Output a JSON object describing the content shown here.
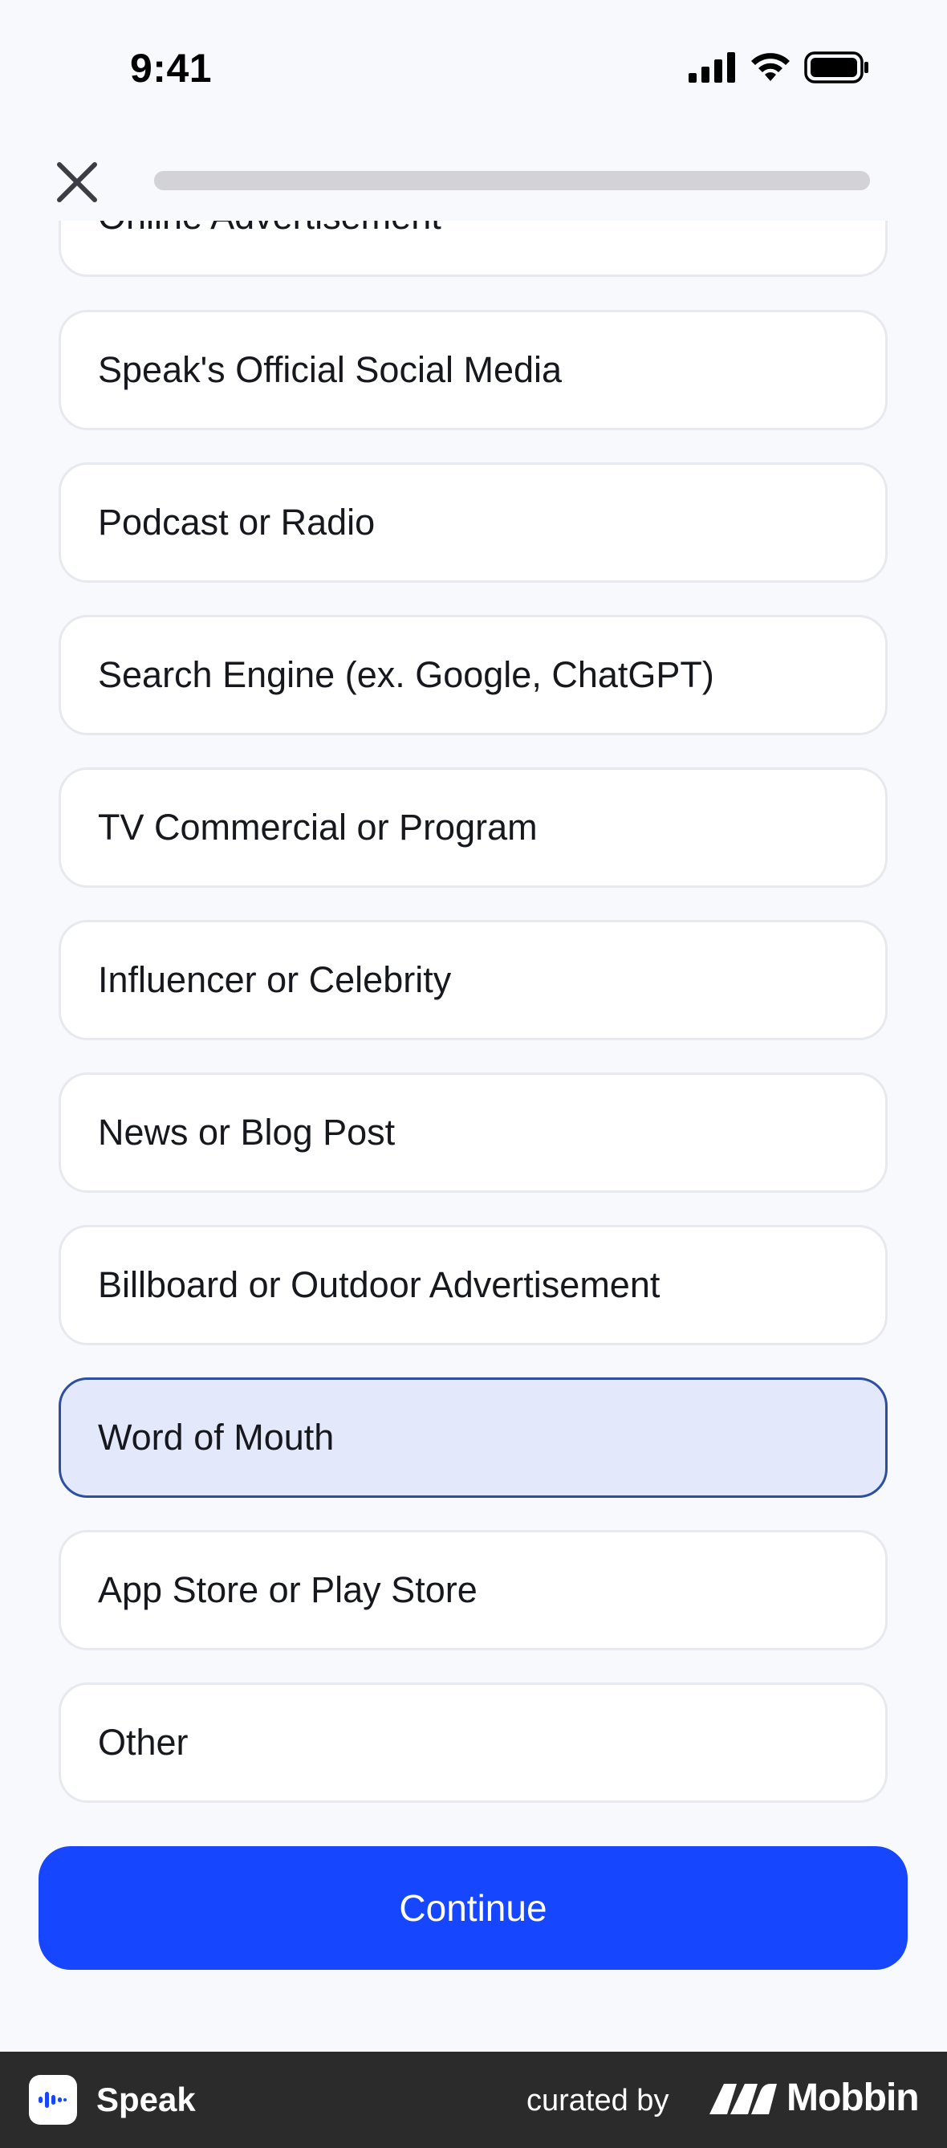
{
  "status_bar": {
    "time": "9:41"
  },
  "header": {
    "close_icon": "close-icon",
    "progress_percent": 100
  },
  "options": [
    {
      "label": "Online Advertisement",
      "selected": false
    },
    {
      "label": "Speak's Official Social Media",
      "selected": false
    },
    {
      "label": "Podcast or Radio",
      "selected": false
    },
    {
      "label": "Search Engine (ex. Google, ChatGPT)",
      "selected": false
    },
    {
      "label": "TV Commercial or Program",
      "selected": false
    },
    {
      "label": "Influencer or Celebrity",
      "selected": false
    },
    {
      "label": "News or Blog Post",
      "selected": false
    },
    {
      "label": "Billboard or Outdoor Advertisement",
      "selected": false
    },
    {
      "label": "Word of Mouth",
      "selected": true
    },
    {
      "label": "App Store or Play Store",
      "selected": false
    },
    {
      "label": "Other",
      "selected": false
    }
  ],
  "continue_label": "Continue",
  "footer": {
    "app_name": "Speak",
    "curated_by": "curated by",
    "brand": "Mobbin"
  },
  "colors": {
    "accent": "#1746ff",
    "selected_bg": "#e3e9fb",
    "selected_border": "#2c4fa0",
    "background": "#f7f9fd"
  }
}
